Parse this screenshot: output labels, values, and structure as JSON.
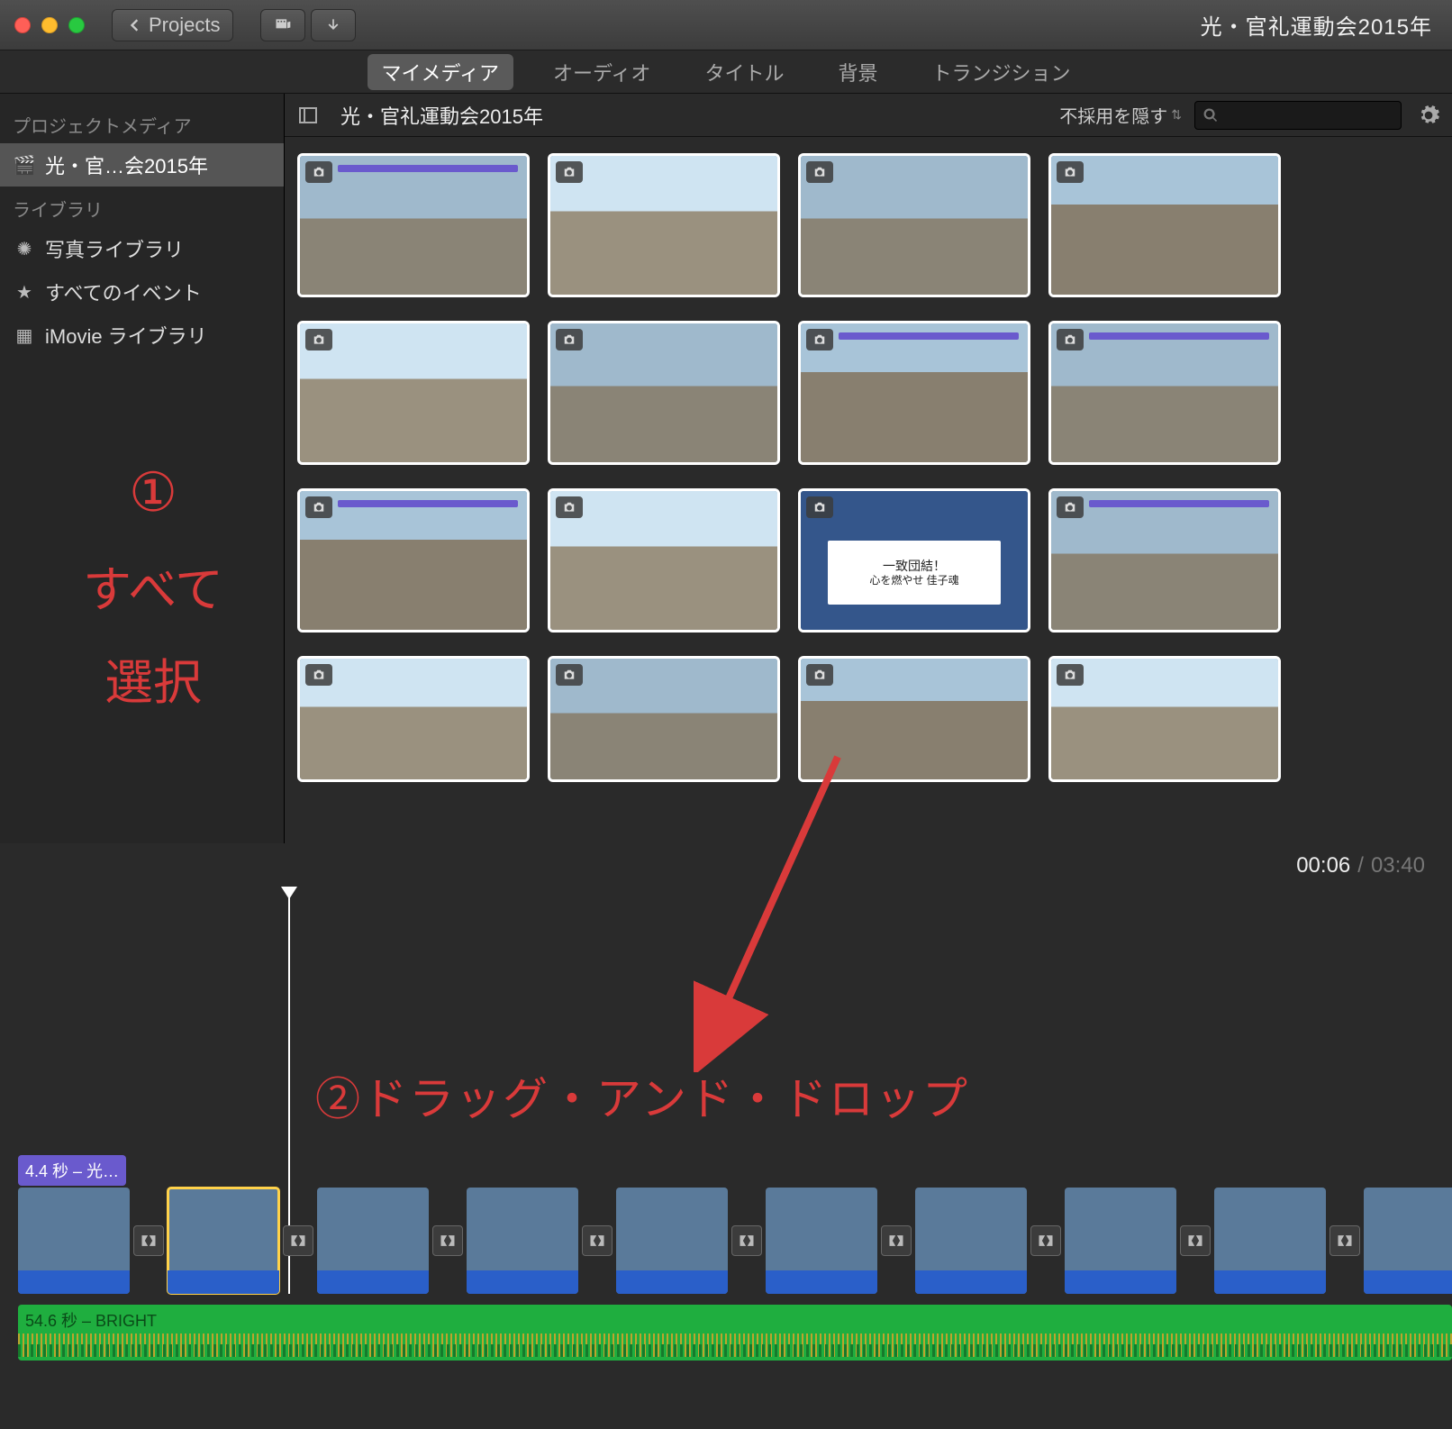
{
  "window": {
    "title": "光・官礼運動会2015年"
  },
  "titlebar": {
    "back_label": "Projects",
    "icons": {
      "media": "media-icon",
      "share": "share-down-icon"
    }
  },
  "tabs": {
    "items": [
      {
        "label": "マイメディア",
        "active": true
      },
      {
        "label": "オーディオ"
      },
      {
        "label": "タイトル"
      },
      {
        "label": "背景"
      },
      {
        "label": "トランジション"
      }
    ]
  },
  "sidebar": {
    "heading_project": "プロジェクトメディア",
    "project_item": "光・官…会2015年",
    "heading_library": "ライブラリ",
    "items": [
      {
        "icon": "flower-icon",
        "label": "写真ライブラリ"
      },
      {
        "icon": "star-icon",
        "label": "すべてのイベント"
      },
      {
        "icon": "grid-icon",
        "label": "iMovie ライブラリ"
      }
    ]
  },
  "browser": {
    "title": "光・官礼運動会2015年",
    "hide_rejected": "不採用を隠す",
    "search_placeholder": "",
    "banner": {
      "line1": "一致団結！",
      "line2": "心を燃やせ 佳子魂"
    }
  },
  "annotations": {
    "step1_num": "①",
    "step1_a": "すべて",
    "step1_b": "選択",
    "step2": "②ドラッグ・アンド・ドロップ"
  },
  "time": {
    "current": "00:06",
    "total": "03:40"
  },
  "timeline": {
    "clip_label": "4.4 秒 – 光…",
    "audio_label": "54.6 秒 – BRIGHT",
    "clips": 11
  }
}
